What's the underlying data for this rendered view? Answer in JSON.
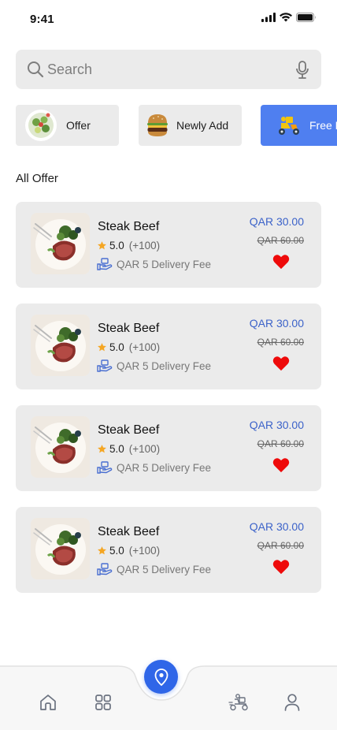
{
  "status_bar": {
    "time": "9:41"
  },
  "search": {
    "placeholder": "Search"
  },
  "categories": [
    {
      "label": "Offer",
      "icon": "salad-icon"
    },
    {
      "label": "Newly Add",
      "icon": "burger-icon"
    },
    {
      "label": "Free D",
      "icon": "delivery-scooter-icon",
      "active": true
    }
  ],
  "section_title": "All Offer",
  "offers": [
    {
      "title": "Steak Beef",
      "rating": "5.0",
      "rating_count": "(+100)",
      "delivery": "QAR 5 Delivery Fee",
      "price": "QAR 30.00",
      "old_price": "QAR 60.00"
    },
    {
      "title": "Steak Beef",
      "rating": "5.0",
      "rating_count": "(+100)",
      "delivery": "QAR 5 Delivery Fee",
      "price": "QAR 30.00",
      "old_price": "QAR 60.00"
    },
    {
      "title": "Steak Beef",
      "rating": "5.0",
      "rating_count": "(+100)",
      "delivery": "QAR 5 Delivery Fee",
      "price": "QAR 30.00",
      "old_price": "QAR 60.00"
    },
    {
      "title": "Steak Beef",
      "rating": "5.0",
      "rating_count": "(+100)",
      "delivery": "QAR 5 Delivery Fee",
      "price": "QAR 30.00",
      "old_price": "QAR 60.00"
    }
  ],
  "bottom_nav": {
    "items": [
      "home-icon",
      "grid-icon",
      "location-pin-icon",
      "delivery-scooter-icon",
      "profile-icon"
    ],
    "active": "location-pin-icon"
  },
  "colors": {
    "accent": "#2f66e8",
    "chip_active": "#4f7ff0",
    "price": "#3b62c9",
    "heart": "#ee0a0a",
    "star": "#f5a623",
    "card_bg": "#ebebeb"
  }
}
